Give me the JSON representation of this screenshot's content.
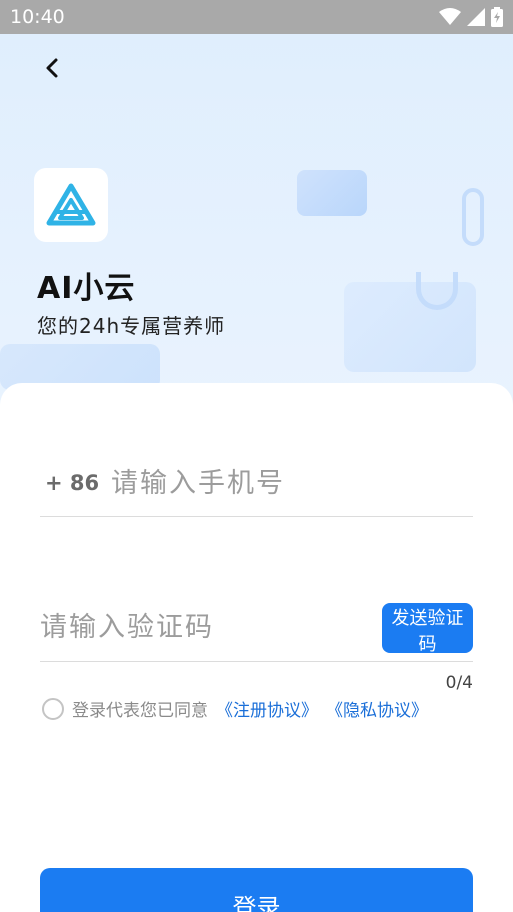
{
  "status_bar": {
    "time": "10:40",
    "icons": [
      "wifi-icon",
      "signal-icon",
      "battery-icon"
    ]
  },
  "header": {
    "back_icon": "chevron-left-icon",
    "logo_icon": "triangle-logo-icon",
    "app_name": "AI小云",
    "subtitle": "您的24h专属营养师"
  },
  "form": {
    "country_code": "+ 86",
    "phone_placeholder": "请输入手机号",
    "code_placeholder": "请输入验证码",
    "send_code_label": "发送验证码",
    "code_counter": "0/4"
  },
  "agreement": {
    "prefix": "登录代表您已同意",
    "register_link": "《注册协议》",
    "privacy_link": "《隐私协议》"
  },
  "login_label": "登录",
  "colors": {
    "accent": "#1b7cf2",
    "link": "#1b6fd8",
    "logo": "#2fb3e6"
  }
}
